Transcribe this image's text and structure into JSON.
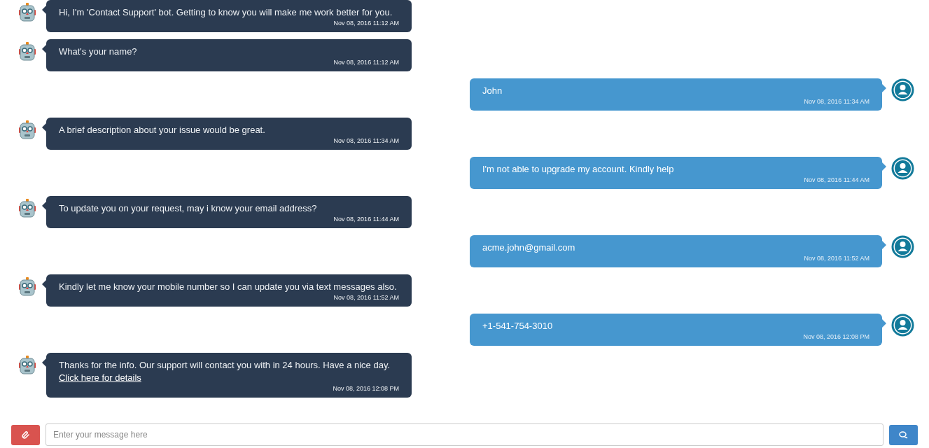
{
  "messages": [
    {
      "kind": "bot",
      "text": "Hi, I'm 'Contact Support' bot. Getting to know you will make me work better for you.",
      "time": "Nov 08, 2016 11:12 AM"
    },
    {
      "kind": "bot",
      "text": "What's your name?",
      "time": "Nov 08, 2016 11:12 AM"
    },
    {
      "kind": "user",
      "text": "John",
      "time": "Nov 08, 2016 11:34 AM"
    },
    {
      "kind": "bot",
      "text": "A brief description about your issue would be great.",
      "time": "Nov 08, 2016 11:34 AM"
    },
    {
      "kind": "user",
      "text": "I'm not able to upgrade my account. Kindly help",
      "time": "Nov 08, 2016 11:44 AM"
    },
    {
      "kind": "bot",
      "text": "To update you on your request, may i know your email address?",
      "time": "Nov 08, 2016 11:44 AM"
    },
    {
      "kind": "user",
      "text": "acme.john@gmail.com",
      "time": "Nov 08, 2016 11:52 AM"
    },
    {
      "kind": "bot",
      "text": "Kindly let me know your mobile number so I can update you via text messages also.",
      "time": "Nov 08, 2016 11:52 AM"
    },
    {
      "kind": "user",
      "text": "+1-541-754-3010",
      "time": "Nov 08, 2016 12:08 PM"
    },
    {
      "kind": "bot",
      "text": "Thanks for the info. Our support will contact you with in 24 hours. Have a nice day.",
      "link": "Click here for details",
      "time": "Nov 08, 2016 12:08 PM"
    }
  ],
  "composer": {
    "placeholder": "Enter your message here"
  }
}
